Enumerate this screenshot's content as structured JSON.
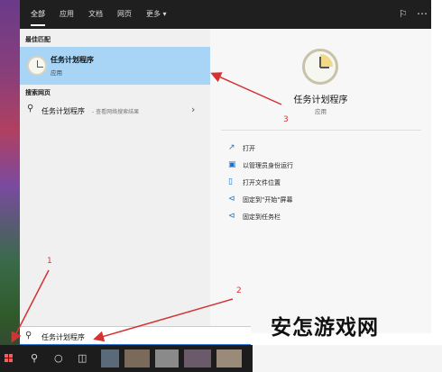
{
  "tabs": [
    "全部",
    "应用",
    "文档",
    "网页",
    "更多 ▾"
  ],
  "left_pane": {
    "best_match_header": "最佳匹配",
    "best_match": {
      "title": "任务计划程序",
      "subtitle": "应用"
    },
    "web_header": "搜索网页",
    "web_result": {
      "text": "任务计划程序",
      "hint": " - 查看网络搜索结果"
    }
  },
  "right_pane": {
    "title": "任务计划程序",
    "subtitle": "应用",
    "actions": [
      "打开",
      "以管理员身份运行",
      "打开文件位置",
      "固定到\"开始\"屏幕",
      "固定到任务栏"
    ]
  },
  "search": {
    "value": "任务计划程序"
  },
  "annotations": {
    "n1": "1",
    "n2": "2",
    "n3": "3"
  },
  "watermark": "安怎游戏网",
  "colors": {
    "accent": "#2a7ad6",
    "selection": "#a8d4f5",
    "arrow": "#d33333"
  },
  "icons": {
    "best_match": "clock-icon",
    "web": "search-icon",
    "actions": [
      "open-icon",
      "run-as-admin-icon",
      "file-location-icon",
      "pin-start-icon",
      "pin-taskbar-icon"
    ]
  }
}
